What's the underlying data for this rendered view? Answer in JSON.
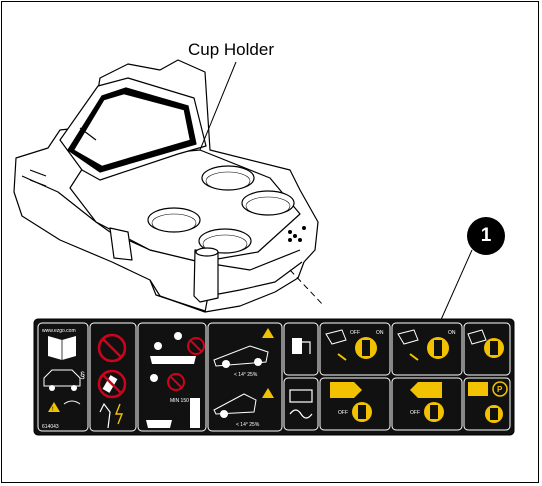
{
  "figure": {
    "callout_label": "Cup Holder",
    "item_number": "1",
    "decal_small_texts": {
      "website": "www.ezgo.com",
      "part_number": "614043",
      "section": "§",
      "min_label": "MIN 150",
      "slope_1": "< 14° 25%",
      "slope_2": "< 14° 25%",
      "off": "OFF",
      "on": "ON",
      "park_letter": "P"
    }
  },
  "colors": {
    "decal_background": "#111111",
    "warning_yellow": "#f2c200",
    "prohibition_red": "#d0021b",
    "outline": "#000000"
  }
}
